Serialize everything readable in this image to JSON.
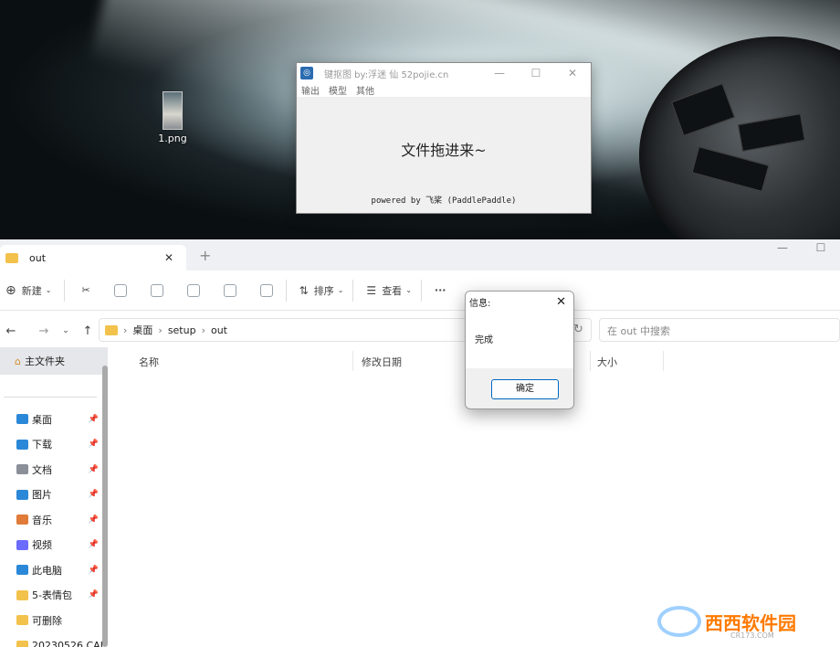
{
  "desktop": {
    "icon_label": "1.png"
  },
  "app_window": {
    "title": "键抠图  by:浮迷   仙 52pojie.cn",
    "menus": [
      "输出",
      "模型",
      "其他"
    ],
    "drop_text": "文件拖进来~",
    "powered_by": "powered by 飞桨 (PaddlePaddle)"
  },
  "explorer": {
    "tab_title": "out",
    "toolbar": {
      "new_label": "新建",
      "sort_label": "排序",
      "view_label": "查看",
      "more_label": "···"
    },
    "breadcrumb": [
      "桌面",
      "setup",
      "out"
    ],
    "search_placeholder": "在 out 中搜索",
    "sidebar": {
      "home": "主文件夹",
      "items": [
        {
          "label": "桌面",
          "icon": "desktop-icon",
          "color": "#2b88d8"
        },
        {
          "label": "下载",
          "icon": "download-icon",
          "color": "#2b88d8"
        },
        {
          "label": "文档",
          "icon": "document-icon",
          "color": "#8a8f98"
        },
        {
          "label": "图片",
          "icon": "pictures-icon",
          "color": "#2b88d8"
        },
        {
          "label": "音乐",
          "icon": "music-icon",
          "color": "#e07b39"
        },
        {
          "label": "视频",
          "icon": "video-icon",
          "color": "#6b6bff"
        },
        {
          "label": "此电脑",
          "icon": "computer-icon",
          "color": "#2b88d8"
        },
        {
          "label": "5-表情包",
          "icon": "folder-icon",
          "color": "#f3c24c"
        },
        {
          "label": "可删除",
          "icon": "folder-icon",
          "color": "#f3c24c"
        },
        {
          "label": "20230526 CAI",
          "icon": "folder-icon",
          "color": "#f3c24c"
        }
      ]
    },
    "columns": [
      "名称",
      "修改日期",
      "大小"
    ]
  },
  "dialog": {
    "title": "信息:",
    "message": "完成",
    "ok_label": "确定"
  },
  "watermark": {
    "text": "西西软件园",
    "sub": "CR173.COM"
  }
}
